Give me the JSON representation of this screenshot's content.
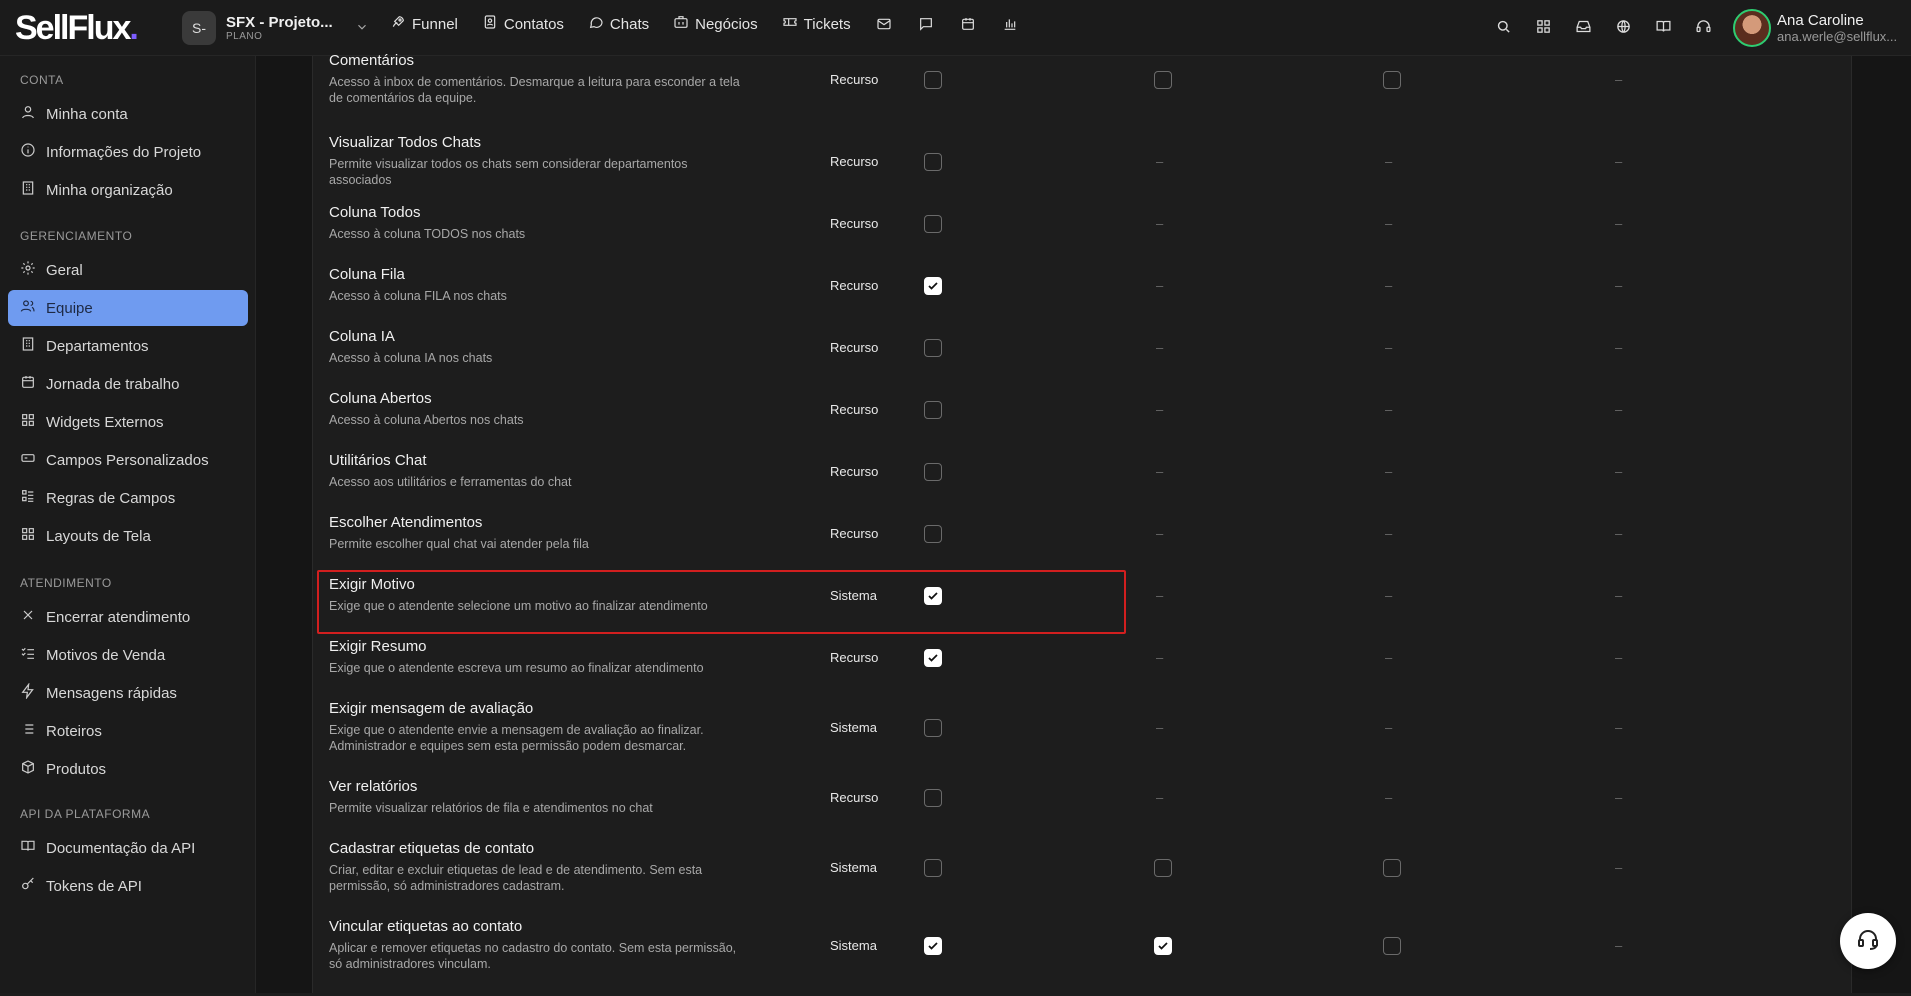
{
  "brand": {
    "name": "SellFlux",
    "dot": "."
  },
  "project": {
    "avatar": "S-",
    "name": "SFX - Projeto...",
    "plan": "PLANO"
  },
  "nav": [
    {
      "label": "Funnel",
      "icon": "rocket-icon"
    },
    {
      "label": "Contatos",
      "icon": "contacts-icon"
    },
    {
      "label": "Chats",
      "icon": "chat-bubble-icon"
    },
    {
      "label": "Negócios",
      "icon": "briefcase-icon"
    },
    {
      "label": "Tickets",
      "icon": "ticket-icon"
    }
  ],
  "nav_icons": [
    "mail-icon",
    "message-icon",
    "calendar-icon",
    "bar-chart-icon"
  ],
  "right_icons": [
    "search-icon",
    "apps-grid-icon",
    "inbox-icon",
    "globe-icon",
    "book-icon",
    "headset-icon"
  ],
  "user": {
    "name": "Ana Caroline",
    "email": "ana.werle@sellflux..."
  },
  "sidebar": {
    "sections": [
      {
        "title": "CONTA",
        "items": [
          {
            "label": "Minha conta",
            "icon": "user-icon"
          },
          {
            "label": "Informações do Projeto",
            "icon": "info-icon"
          },
          {
            "label": "Minha organização",
            "icon": "building-icon"
          }
        ]
      },
      {
        "title": "GERENCIAMENTO",
        "items": [
          {
            "label": "Geral",
            "icon": "gear-icon"
          },
          {
            "label": "Equipe",
            "icon": "team-icon",
            "active": true
          },
          {
            "label": "Departamentos",
            "icon": "building-icon"
          },
          {
            "label": "Jornada de trabalho",
            "icon": "calendar-icon"
          },
          {
            "label": "Widgets Externos",
            "icon": "widgets-icon"
          },
          {
            "label": "Campos Personalizados",
            "icon": "input-field-icon"
          },
          {
            "label": "Regras de Campos",
            "icon": "rules-list-icon"
          },
          {
            "label": "Layouts de Tela",
            "icon": "layout-grid-icon"
          }
        ]
      },
      {
        "title": "ATENDIMENTO",
        "items": [
          {
            "label": "Encerrar atendimento",
            "icon": "close-icon"
          },
          {
            "label": "Motivos de Venda",
            "icon": "checklist-icon"
          },
          {
            "label": "Mensagens rápidas",
            "icon": "lightning-icon"
          },
          {
            "label": "Roteiros",
            "icon": "list-icon"
          },
          {
            "label": "Produtos",
            "icon": "package-icon"
          }
        ]
      },
      {
        "title": "API DA PLATAFORMA",
        "items": [
          {
            "label": "Documentação da API",
            "icon": "book-icon"
          },
          {
            "label": "Tokens de API",
            "icon": "key-icon"
          }
        ]
      }
    ]
  },
  "permissions": {
    "dash": "–",
    "rows": [
      {
        "title": "Comentários",
        "desc": "Acesso à inbox de comentários. Desmarque a leitura para esconder a tela de comentários da equipe.",
        "type": "Recurso",
        "cols": [
          "unchecked",
          "unchecked",
          "unchecked",
          "dash"
        ]
      },
      {
        "title": "Visualizar Todos Chats",
        "desc": "Permite visualizar todos os chats sem considerar departamentos associados",
        "type": "Recurso",
        "cols": [
          "unchecked",
          "dash",
          "dash",
          "dash"
        ]
      },
      {
        "title": "Coluna Todos",
        "desc": "Acesso à coluna TODOS nos chats",
        "type": "Recurso",
        "cols": [
          "unchecked",
          "dash",
          "dash",
          "dash"
        ]
      },
      {
        "title": "Coluna Fila",
        "desc": "Acesso à coluna FILA nos chats",
        "type": "Recurso",
        "cols": [
          "checked",
          "dash",
          "dash",
          "dash"
        ]
      },
      {
        "title": "Coluna IA",
        "desc": "Acesso à coluna IA nos chats",
        "type": "Recurso",
        "cols": [
          "unchecked",
          "dash",
          "dash",
          "dash"
        ]
      },
      {
        "title": "Coluna Abertos",
        "desc": "Acesso à coluna Abertos nos chats",
        "type": "Recurso",
        "cols": [
          "unchecked",
          "dash",
          "dash",
          "dash"
        ]
      },
      {
        "title": "Utilitários Chat",
        "desc": "Acesso aos utilitários e ferramentas do chat",
        "type": "Recurso",
        "cols": [
          "unchecked",
          "dash",
          "dash",
          "dash"
        ]
      },
      {
        "title": "Escolher Atendimentos",
        "desc": "Permite escolher qual chat vai atender pela fila",
        "type": "Recurso",
        "cols": [
          "unchecked",
          "dash",
          "dash",
          "dash"
        ]
      },
      {
        "title": "Exigir Motivo",
        "desc": "Exige que o atendente selecione um motivo ao finalizar atendimento",
        "type": "Sistema",
        "cols": [
          "checked",
          "dash",
          "dash",
          "dash"
        ],
        "highlighted": true
      },
      {
        "title": "Exigir Resumo",
        "desc": "Exige que o atendente escreva um resumo ao finalizar atendimento",
        "type": "Recurso",
        "cols": [
          "checked",
          "dash",
          "dash",
          "dash"
        ]
      },
      {
        "title": "Exigir mensagem de avaliação",
        "desc": "Exige que o atendente envie a mensagem de avaliação ao finalizar. Administrador e equipes sem esta permissão podem desmarcar.",
        "type": "Sistema",
        "cols": [
          "unchecked",
          "dash",
          "dash",
          "dash"
        ]
      },
      {
        "title": "Ver relatórios",
        "desc": "Permite visualizar relatórios de fila e atendimentos no chat",
        "type": "Recurso",
        "cols": [
          "unchecked",
          "dash",
          "dash",
          "dash"
        ]
      },
      {
        "title": "Cadastrar etiquetas de contato",
        "desc": "Criar, editar e excluir etiquetas de lead e de atendimento. Sem esta permissão, só administradores cadastram.",
        "type": "Sistema",
        "cols": [
          "unchecked",
          "unchecked",
          "unchecked",
          "dash"
        ]
      },
      {
        "title": "Vincular etiquetas ao contato",
        "desc": "Aplicar e remover etiquetas no cadastro do contato. Sem esta permissão, só administradores vinculam.",
        "type": "Sistema",
        "cols": [
          "checked",
          "checked",
          "unchecked",
          "dash"
        ]
      }
    ]
  },
  "support_button": {
    "icon": "headset-icon"
  },
  "colors": {
    "accent": "#6f9bf0",
    "highlight": "#d21f1f",
    "background": "#1d1d1d"
  }
}
